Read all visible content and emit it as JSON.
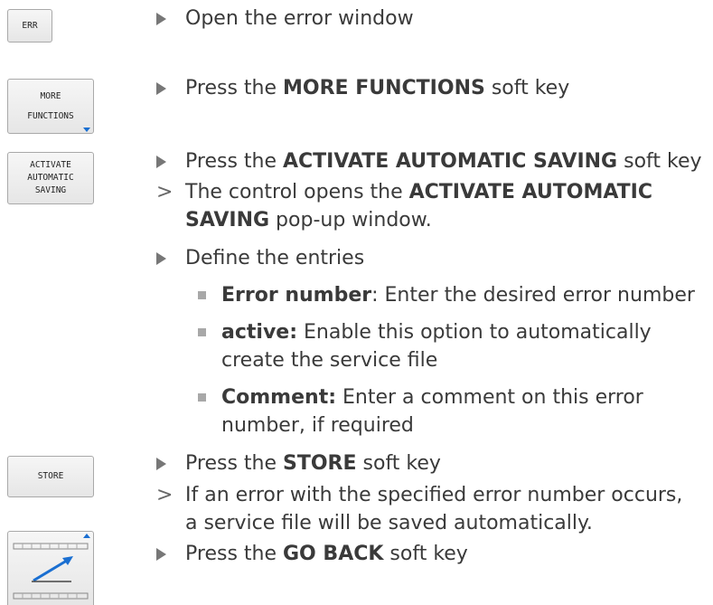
{
  "keys": {
    "err": "ERR",
    "more_1": "MORE",
    "more_2": "FUNCTIONS",
    "activate_1": "ACTIVATE",
    "activate_2": "AUTOMATIC",
    "activate_3": "SAVING",
    "store": "STORE",
    "back_icon": "go-back-arrow-icon"
  },
  "steps": {
    "open_error_window": "Open the error window",
    "press_1": "Press the ",
    "more_functions": "MORE FUNCTIONS",
    "soft_key_1": " soft key",
    "press_2": "Press the ",
    "activate_automatic_saving": "ACTIVATE AUTOMATIC SAVING",
    "soft_key_2": " soft key",
    "control_opens": "The control opens the ",
    "activate_automatic": "ACTIVATE AUTOMATIC",
    "saving": "SAVING",
    "popup_window": " pop-up window.",
    "define_entries": "Define the entries",
    "error_number_label": "Error number",
    "error_number_text": ": Enter the desired error number",
    "active_label": "active:",
    "active_text_1": " Enable this option to automatically",
    "active_text_2": "create the service file",
    "comment_label": "Comment:",
    "comment_text_1": " Enter a comment on this error",
    "comment_text_2": "number, if required",
    "press_3": "Press the ",
    "store": "STORE",
    "soft_key_3": " soft key",
    "if_error_1": "If an error with the specified error number occurs,",
    "if_error_2": "a service file will be saved automatically.",
    "press_4": "Press the ",
    "go_back": "GO BACK",
    "soft_key_4": " soft key"
  }
}
